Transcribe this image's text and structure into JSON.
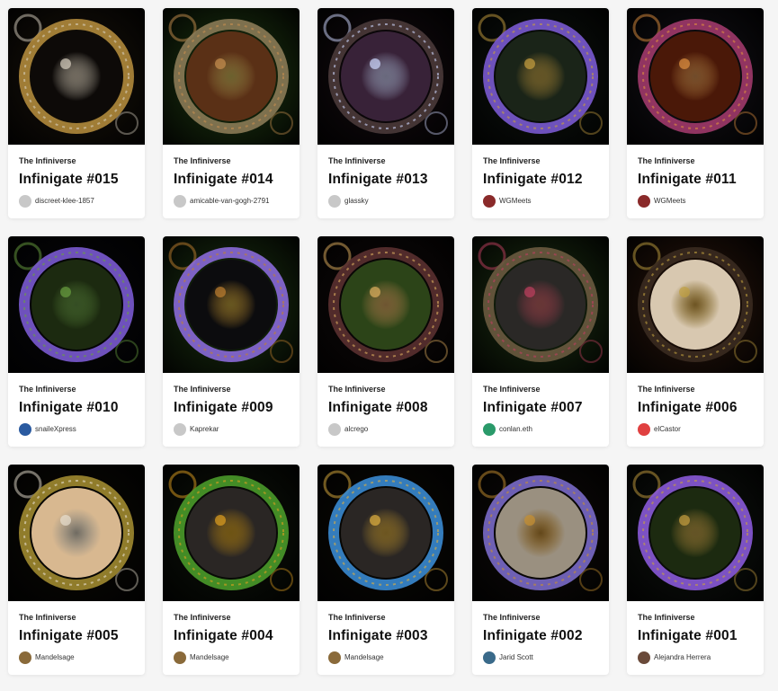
{
  "collection_label": "The Infiniverse",
  "cards": [
    {
      "title": "Infinigate #015",
      "owner": "discreet-klee-1857",
      "bg": "#1a140c",
      "ring": "#b08a3c",
      "core": "#0d0a08",
      "accent": "#d8d0c0",
      "avatar": "#c8c8c8"
    },
    {
      "title": "Infinigate #014",
      "owner": "amicable-van-gogh-2791",
      "bg": "#1f3a12",
      "ring": "#8a7a56",
      "core": "#5a3016",
      "accent": "#c89050",
      "avatar": "#c8c8c8"
    },
    {
      "title": "Infinigate #013",
      "owner": "glassky",
      "bg": "#140c10",
      "ring": "#4a3a3a",
      "core": "#382238",
      "accent": "#cfd8ff",
      "avatar": "#c8c8c8"
    },
    {
      "title": "Infinigate #012",
      "owner": "WGMeets",
      "bg": "#0e1410",
      "ring": "#7a5ad0",
      "core": "#1a2418",
      "accent": "#c8a040",
      "avatar": "#8a2a2a"
    },
    {
      "title": "Infinigate #011",
      "owner": "WGMeets",
      "bg": "#141218",
      "ring": "#a03a6a",
      "core": "#4a1808",
      "accent": "#e09040",
      "avatar": "#8a2a2a"
    },
    {
      "title": "Infinigate #010",
      "owner": "snaileXpress",
      "bg": "#08080c",
      "ring": "#7a5ad0",
      "core": "#1c2a10",
      "accent": "#6aa040",
      "avatar": "#2a5aa0"
    },
    {
      "title": "Infinigate #009",
      "owner": "Kaprekar",
      "bg": "#1c3412",
      "ring": "#8a6ad8",
      "core": "#0c0c0e",
      "accent": "#c08030",
      "avatar": "#c8c8c8"
    },
    {
      "title": "Infinigate #008",
      "owner": "alcrego",
      "bg": "#100a0a",
      "ring": "#5a3030",
      "core": "#2c4418",
      "accent": "#e0b060",
      "avatar": "#c8c8c8"
    },
    {
      "title": "Infinigate #007",
      "owner": "conlan.eth",
      "bg": "#1c3012",
      "ring": "#6a5a40",
      "core": "#2a2826",
      "accent": "#c04060",
      "avatar": "#2a9a6a"
    },
    {
      "title": "Infinigate #006",
      "owner": "elCastor",
      "bg": "#2a160c",
      "ring": "#3a2a20",
      "core": "#d8c8b0",
      "accent": "#c0a040",
      "avatar": "#e04040"
    },
    {
      "title": "Infinigate #005",
      "owner": "Mandelsage",
      "bg": "#0c0a06",
      "ring": "#a08a30",
      "core": "#d8b890",
      "accent": "#e8e0d0",
      "avatar": "#8a6a3a"
    },
    {
      "title": "Infinigate #004",
      "owner": "Mandelsage",
      "bg": "#0e140a",
      "ring": "#4a9a2a",
      "core": "#2a2624",
      "accent": "#e0a020",
      "avatar": "#8a6a3a"
    },
    {
      "title": "Infinigate #003",
      "owner": "Mandelsage",
      "bg": "#0c0a06",
      "ring": "#3a8ad0",
      "core": "#2a2624",
      "accent": "#e0b040",
      "avatar": "#8a6a3a"
    },
    {
      "title": "Infinigate #002",
      "owner": "Jarid Scott",
      "bg": "#100c0a",
      "ring": "#7a6ac8",
      "core": "#9a9080",
      "accent": "#c89030",
      "avatar": "#3a6a8a"
    },
    {
      "title": "Infinigate #001",
      "owner": "Alejandra Herrera",
      "bg": "#101410",
      "ring": "#8a5ad8",
      "core": "#1c2a10",
      "accent": "#c8a040",
      "avatar": "#6a4a3a"
    }
  ]
}
